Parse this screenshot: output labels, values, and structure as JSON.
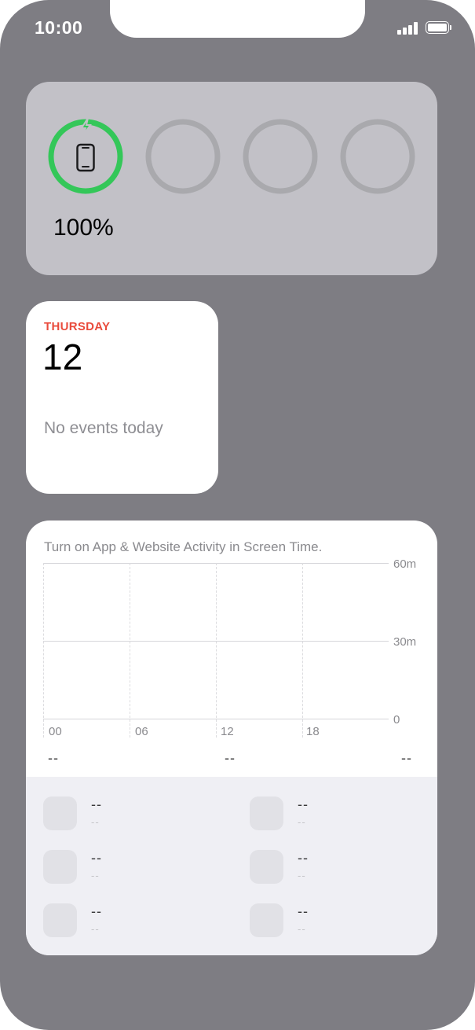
{
  "status_bar": {
    "time": "10:00"
  },
  "battery_widget": {
    "percent": "100%",
    "level": 1.0,
    "ring_color": "#34c759",
    "icons": [
      "bolt-icon",
      "iphone-icon"
    ]
  },
  "calendar_widget": {
    "day": "THURSDAY",
    "date": "12",
    "no_events": "No events today",
    "day_color": "#e94b3c"
  },
  "screen_time_widget": {
    "message": "Turn on App & Website Activity in Screen Time.",
    "y_labels": [
      "60m",
      "30m",
      "0"
    ],
    "x_labels": [
      "00",
      "06",
      "12",
      "18"
    ],
    "summary": [
      "--",
      "--",
      "--"
    ],
    "apps": [
      {
        "name": "--",
        "time": "--"
      },
      {
        "name": "--",
        "time": "--"
      },
      {
        "name": "--",
        "time": "--"
      },
      {
        "name": "--",
        "time": "--"
      },
      {
        "name": "--",
        "time": "--"
      },
      {
        "name": "--",
        "time": "--"
      }
    ]
  }
}
